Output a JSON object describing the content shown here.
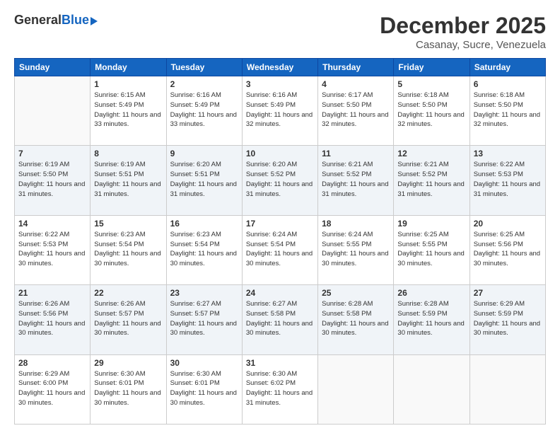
{
  "header": {
    "logo_general": "General",
    "logo_blue": "Blue",
    "month_title": "December 2025",
    "location": "Casanay, Sucre, Venezuela"
  },
  "days_of_week": [
    "Sunday",
    "Monday",
    "Tuesday",
    "Wednesday",
    "Thursday",
    "Friday",
    "Saturday"
  ],
  "weeks": [
    [
      {
        "day": "",
        "sunrise": "",
        "sunset": "",
        "daylight": ""
      },
      {
        "day": "1",
        "sunrise": "Sunrise: 6:15 AM",
        "sunset": "Sunset: 5:49 PM",
        "daylight": "Daylight: 11 hours and 33 minutes."
      },
      {
        "day": "2",
        "sunrise": "Sunrise: 6:16 AM",
        "sunset": "Sunset: 5:49 PM",
        "daylight": "Daylight: 11 hours and 33 minutes."
      },
      {
        "day": "3",
        "sunrise": "Sunrise: 6:16 AM",
        "sunset": "Sunset: 5:49 PM",
        "daylight": "Daylight: 11 hours and 32 minutes."
      },
      {
        "day": "4",
        "sunrise": "Sunrise: 6:17 AM",
        "sunset": "Sunset: 5:50 PM",
        "daylight": "Daylight: 11 hours and 32 minutes."
      },
      {
        "day": "5",
        "sunrise": "Sunrise: 6:18 AM",
        "sunset": "Sunset: 5:50 PM",
        "daylight": "Daylight: 11 hours and 32 minutes."
      },
      {
        "day": "6",
        "sunrise": "Sunrise: 6:18 AM",
        "sunset": "Sunset: 5:50 PM",
        "daylight": "Daylight: 11 hours and 32 minutes."
      }
    ],
    [
      {
        "day": "7",
        "sunrise": "Sunrise: 6:19 AM",
        "sunset": "Sunset: 5:50 PM",
        "daylight": "Daylight: 11 hours and 31 minutes."
      },
      {
        "day": "8",
        "sunrise": "Sunrise: 6:19 AM",
        "sunset": "Sunset: 5:51 PM",
        "daylight": "Daylight: 11 hours and 31 minutes."
      },
      {
        "day": "9",
        "sunrise": "Sunrise: 6:20 AM",
        "sunset": "Sunset: 5:51 PM",
        "daylight": "Daylight: 11 hours and 31 minutes."
      },
      {
        "day": "10",
        "sunrise": "Sunrise: 6:20 AM",
        "sunset": "Sunset: 5:52 PM",
        "daylight": "Daylight: 11 hours and 31 minutes."
      },
      {
        "day": "11",
        "sunrise": "Sunrise: 6:21 AM",
        "sunset": "Sunset: 5:52 PM",
        "daylight": "Daylight: 11 hours and 31 minutes."
      },
      {
        "day": "12",
        "sunrise": "Sunrise: 6:21 AM",
        "sunset": "Sunset: 5:52 PM",
        "daylight": "Daylight: 11 hours and 31 minutes."
      },
      {
        "day": "13",
        "sunrise": "Sunrise: 6:22 AM",
        "sunset": "Sunset: 5:53 PM",
        "daylight": "Daylight: 11 hours and 31 minutes."
      }
    ],
    [
      {
        "day": "14",
        "sunrise": "Sunrise: 6:22 AM",
        "sunset": "Sunset: 5:53 PM",
        "daylight": "Daylight: 11 hours and 30 minutes."
      },
      {
        "day": "15",
        "sunrise": "Sunrise: 6:23 AM",
        "sunset": "Sunset: 5:54 PM",
        "daylight": "Daylight: 11 hours and 30 minutes."
      },
      {
        "day": "16",
        "sunrise": "Sunrise: 6:23 AM",
        "sunset": "Sunset: 5:54 PM",
        "daylight": "Daylight: 11 hours and 30 minutes."
      },
      {
        "day": "17",
        "sunrise": "Sunrise: 6:24 AM",
        "sunset": "Sunset: 5:54 PM",
        "daylight": "Daylight: 11 hours and 30 minutes."
      },
      {
        "day": "18",
        "sunrise": "Sunrise: 6:24 AM",
        "sunset": "Sunset: 5:55 PM",
        "daylight": "Daylight: 11 hours and 30 minutes."
      },
      {
        "day": "19",
        "sunrise": "Sunrise: 6:25 AM",
        "sunset": "Sunset: 5:55 PM",
        "daylight": "Daylight: 11 hours and 30 minutes."
      },
      {
        "day": "20",
        "sunrise": "Sunrise: 6:25 AM",
        "sunset": "Sunset: 5:56 PM",
        "daylight": "Daylight: 11 hours and 30 minutes."
      }
    ],
    [
      {
        "day": "21",
        "sunrise": "Sunrise: 6:26 AM",
        "sunset": "Sunset: 5:56 PM",
        "daylight": "Daylight: 11 hours and 30 minutes."
      },
      {
        "day": "22",
        "sunrise": "Sunrise: 6:26 AM",
        "sunset": "Sunset: 5:57 PM",
        "daylight": "Daylight: 11 hours and 30 minutes."
      },
      {
        "day": "23",
        "sunrise": "Sunrise: 6:27 AM",
        "sunset": "Sunset: 5:57 PM",
        "daylight": "Daylight: 11 hours and 30 minutes."
      },
      {
        "day": "24",
        "sunrise": "Sunrise: 6:27 AM",
        "sunset": "Sunset: 5:58 PM",
        "daylight": "Daylight: 11 hours and 30 minutes."
      },
      {
        "day": "25",
        "sunrise": "Sunrise: 6:28 AM",
        "sunset": "Sunset: 5:58 PM",
        "daylight": "Daylight: 11 hours and 30 minutes."
      },
      {
        "day": "26",
        "sunrise": "Sunrise: 6:28 AM",
        "sunset": "Sunset: 5:59 PM",
        "daylight": "Daylight: 11 hours and 30 minutes."
      },
      {
        "day": "27",
        "sunrise": "Sunrise: 6:29 AM",
        "sunset": "Sunset: 5:59 PM",
        "daylight": "Daylight: 11 hours and 30 minutes."
      }
    ],
    [
      {
        "day": "28",
        "sunrise": "Sunrise: 6:29 AM",
        "sunset": "Sunset: 6:00 PM",
        "daylight": "Daylight: 11 hours and 30 minutes."
      },
      {
        "day": "29",
        "sunrise": "Sunrise: 6:30 AM",
        "sunset": "Sunset: 6:01 PM",
        "daylight": "Daylight: 11 hours and 30 minutes."
      },
      {
        "day": "30",
        "sunrise": "Sunrise: 6:30 AM",
        "sunset": "Sunset: 6:01 PM",
        "daylight": "Daylight: 11 hours and 30 minutes."
      },
      {
        "day": "31",
        "sunrise": "Sunrise: 6:30 AM",
        "sunset": "Sunset: 6:02 PM",
        "daylight": "Daylight: 11 hours and 31 minutes."
      },
      {
        "day": "",
        "sunrise": "",
        "sunset": "",
        "daylight": ""
      },
      {
        "day": "",
        "sunrise": "",
        "sunset": "",
        "daylight": ""
      },
      {
        "day": "",
        "sunrise": "",
        "sunset": "",
        "daylight": ""
      }
    ]
  ]
}
